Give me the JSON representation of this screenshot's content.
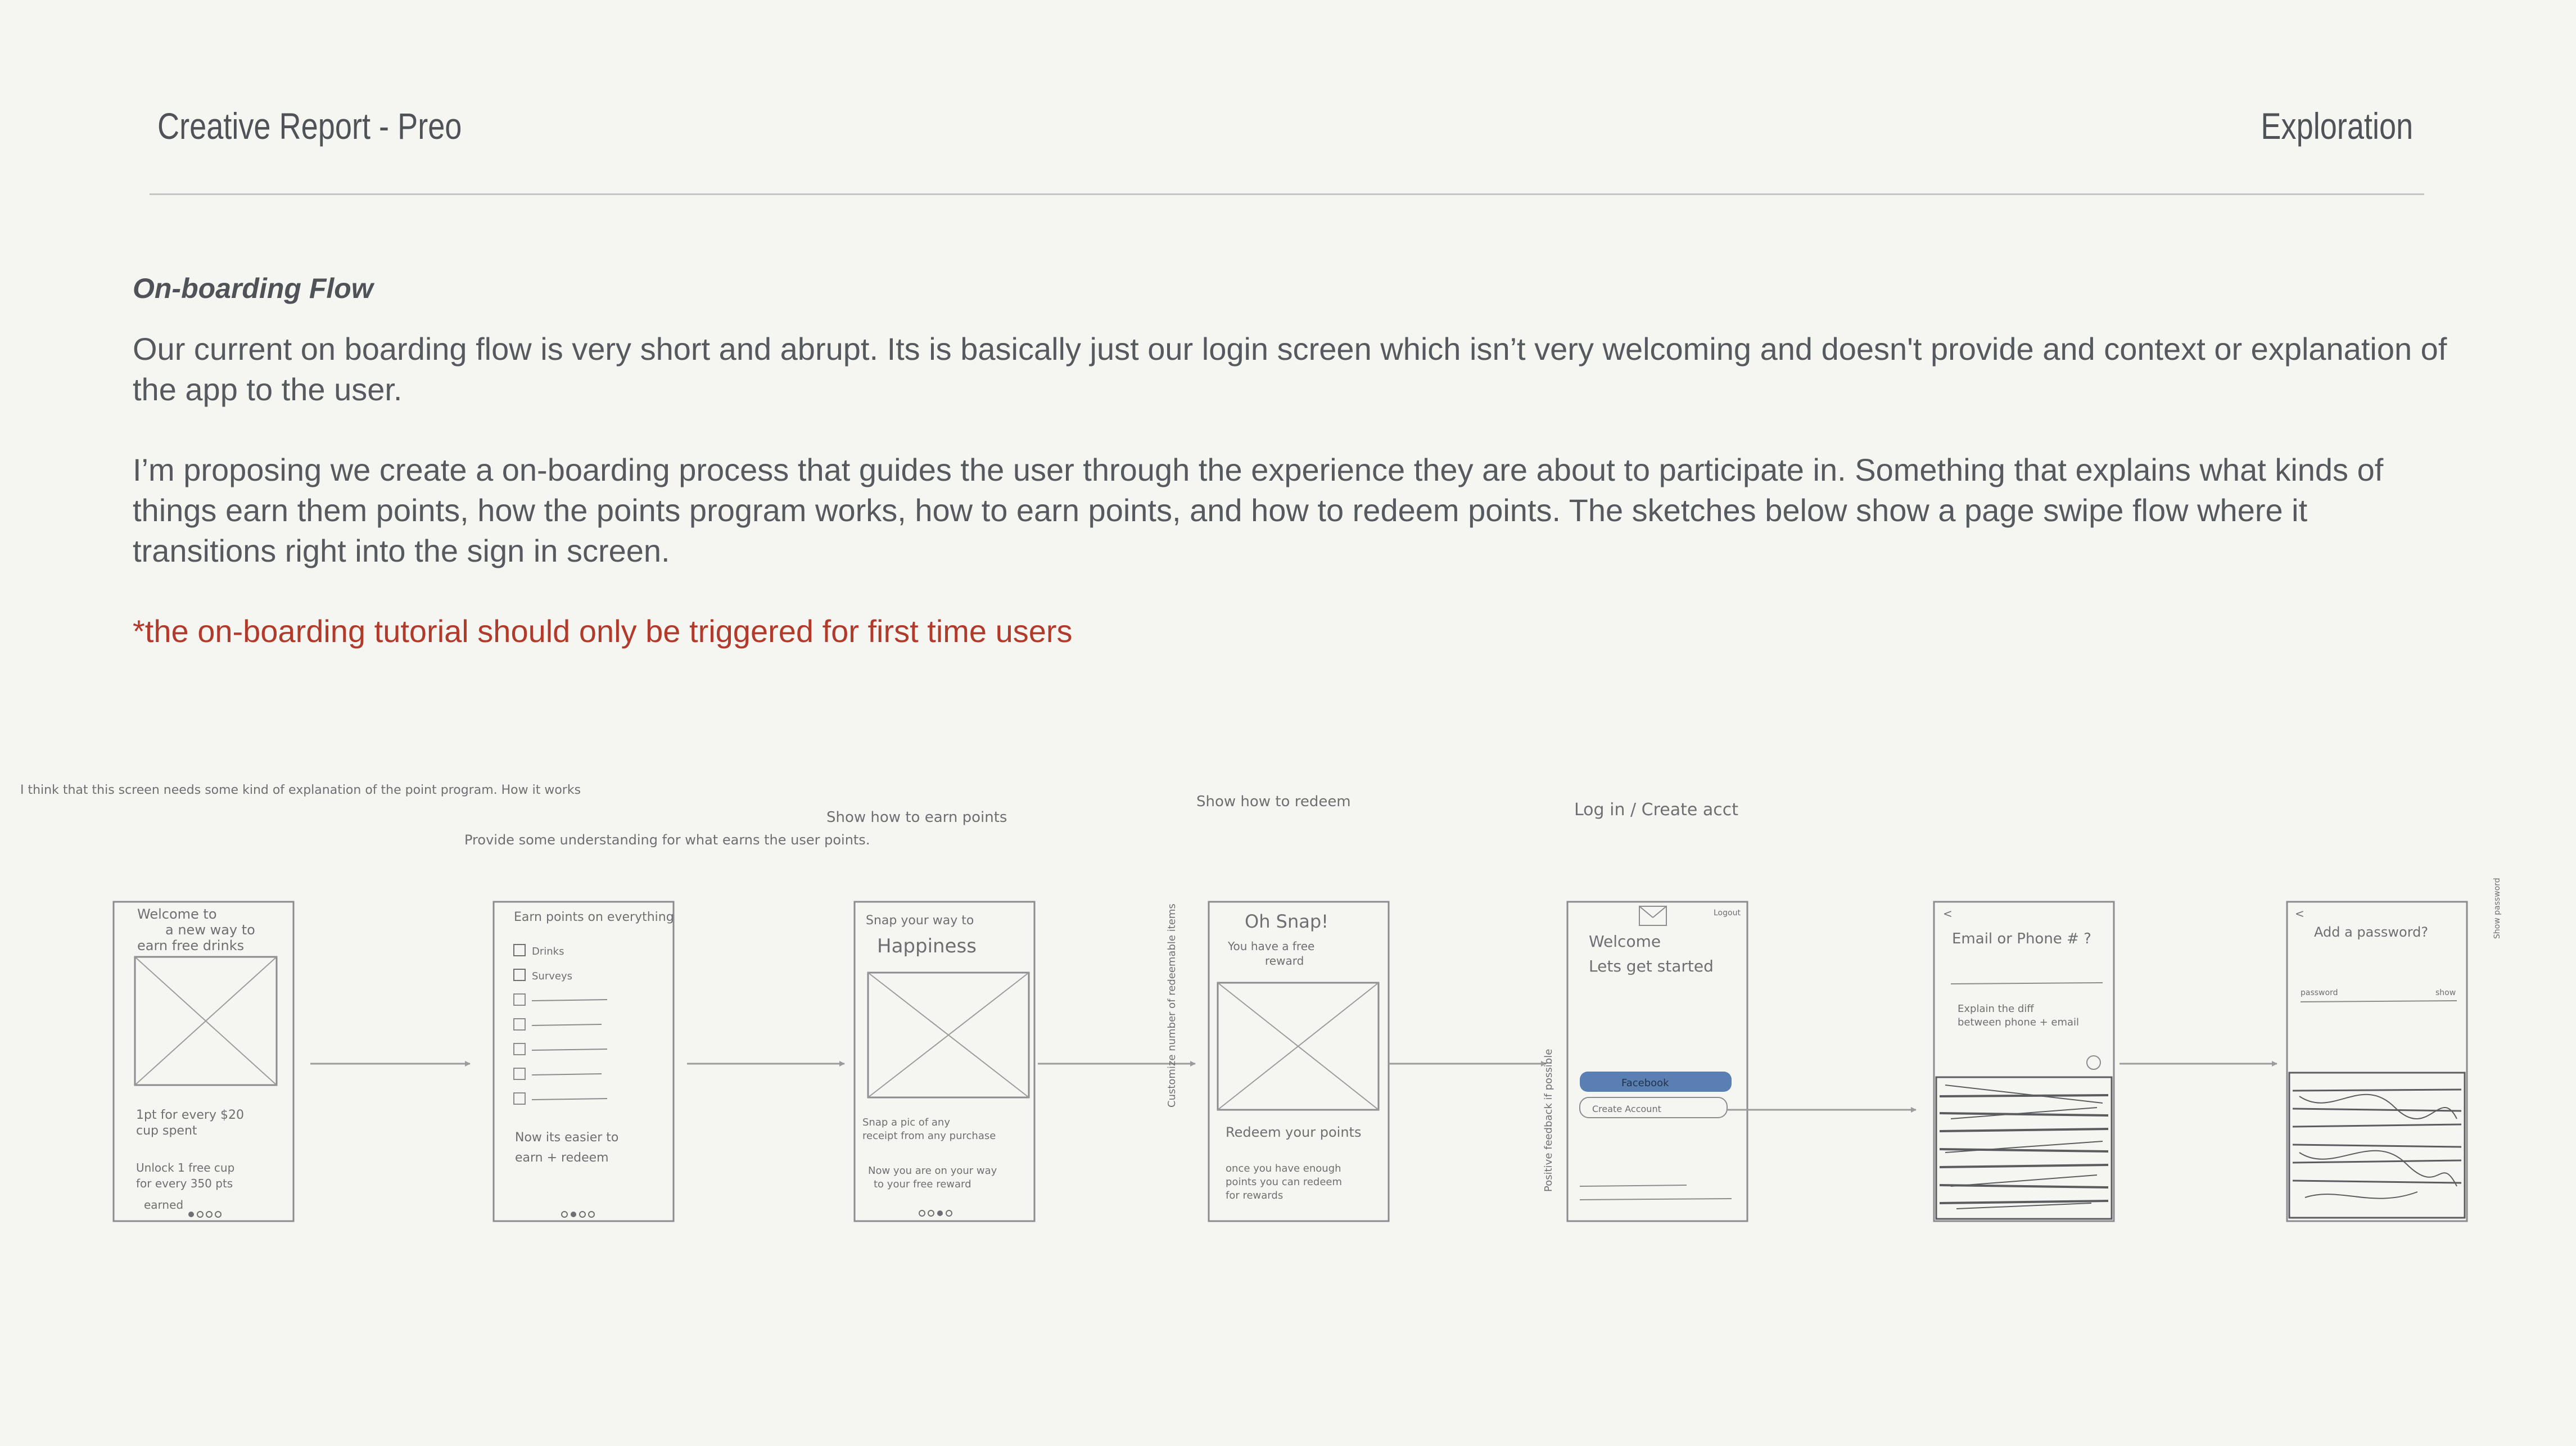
{
  "header": {
    "title": "Creative Report - Preo",
    "section": "Exploration"
  },
  "content": {
    "heading": "On-boarding Flow",
    "paragraph_1": "Our current on boarding flow is very short and abrupt. Its is basically just our login screen which isn’t very welcoming and doesn't provide and context or explanation of the app to the user.",
    "paragraph_2": "I’m proposing we create a on-boarding process that guides the user through the experience they are about to participate in. Something that explains what kinds of things earn them points, how the points program works, how to earn points, and how to redeem points. The sketches below show a page swipe flow where it transitions right into the sign in screen.",
    "note": "*the on-boarding tutorial should only be triggered for first time users",
    "note_color": "#b13a2b"
  },
  "sketches": {
    "annotations": [
      "I think that this screen needs some kind of explanation of the point program. How it works",
      "Provide some understanding for what earns the user points.",
      "Show how to earn points",
      "Show how to redeem",
      "Log in / Create acct"
    ],
    "screens": [
      {
        "top_text": [
          "Welcome to",
          "a new way to",
          "earn free drinks"
        ],
        "bottom_text": [
          "1pt for every $20",
          "cup spent",
          "Unlock 1 free cup",
          "for every 350 pts",
          "earned"
        ]
      },
      {
        "top_text": [
          "Earn points on everything"
        ],
        "list_items": [
          "Drinks",
          "Surveys"
        ],
        "bottom_text": [
          "Now its easier to",
          "earn + redeem"
        ]
      },
      {
        "top_text": [
          "Snap your way to",
          "Happiness"
        ],
        "bottom_text": [
          "Snap a pic of any",
          "receipt from any purchase",
          "Now you are on your way",
          "to your free reward"
        ]
      },
      {
        "top_text": [
          "Oh Snap!",
          "You have a free",
          "reward"
        ],
        "bottom_text": [
          "Redeem your points",
          "once you have enough",
          "points you can redeem",
          "for rewards"
        ]
      },
      {
        "top_text": [
          "Welcome",
          "Lets get started"
        ],
        "button_primary": "Facebook",
        "button_secondary": "Create Account",
        "corner": "Logout"
      },
      {
        "top_text": [
          "Email or Phone # ?"
        ],
        "mid_text": [
          "Explain the diff",
          "between phone + email"
        ]
      },
      {
        "top_text": [
          "Add a password?"
        ],
        "mid_text": [
          "password",
          "show"
        ]
      }
    ],
    "side_notes": [
      "Customize number of redeemable items",
      "Positive feedback if possible",
      "Show password"
    ]
  },
  "colors": {
    "background": "#f5f6f2",
    "text": "#56595d",
    "accent_red": "#b13a2b",
    "sketch_line": "#8a8c8f",
    "facebook_blue": "#5a7fb3"
  }
}
